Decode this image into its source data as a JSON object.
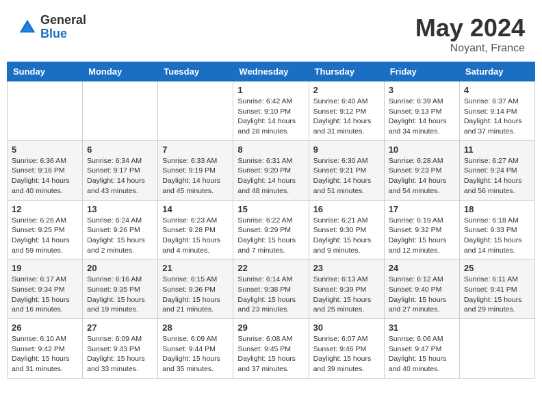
{
  "logo": {
    "general": "General",
    "blue": "Blue"
  },
  "header": {
    "month": "May 2024",
    "location": "Noyant, France"
  },
  "weekdays": [
    "Sunday",
    "Monday",
    "Tuesday",
    "Wednesday",
    "Thursday",
    "Friday",
    "Saturday"
  ],
  "weeks": [
    [
      {
        "day": "",
        "info": ""
      },
      {
        "day": "",
        "info": ""
      },
      {
        "day": "",
        "info": ""
      },
      {
        "day": "1",
        "info": "Sunrise: 6:42 AM\nSunset: 9:10 PM\nDaylight: 14 hours\nand 28 minutes."
      },
      {
        "day": "2",
        "info": "Sunrise: 6:40 AM\nSunset: 9:12 PM\nDaylight: 14 hours\nand 31 minutes."
      },
      {
        "day": "3",
        "info": "Sunrise: 6:39 AM\nSunset: 9:13 PM\nDaylight: 14 hours\nand 34 minutes."
      },
      {
        "day": "4",
        "info": "Sunrise: 6:37 AM\nSunset: 9:14 PM\nDaylight: 14 hours\nand 37 minutes."
      }
    ],
    [
      {
        "day": "5",
        "info": "Sunrise: 6:36 AM\nSunset: 9:16 PM\nDaylight: 14 hours\nand 40 minutes."
      },
      {
        "day": "6",
        "info": "Sunrise: 6:34 AM\nSunset: 9:17 PM\nDaylight: 14 hours\nand 43 minutes."
      },
      {
        "day": "7",
        "info": "Sunrise: 6:33 AM\nSunset: 9:19 PM\nDaylight: 14 hours\nand 45 minutes."
      },
      {
        "day": "8",
        "info": "Sunrise: 6:31 AM\nSunset: 9:20 PM\nDaylight: 14 hours\nand 48 minutes."
      },
      {
        "day": "9",
        "info": "Sunrise: 6:30 AM\nSunset: 9:21 PM\nDaylight: 14 hours\nand 51 minutes."
      },
      {
        "day": "10",
        "info": "Sunrise: 6:28 AM\nSunset: 9:23 PM\nDaylight: 14 hours\nand 54 minutes."
      },
      {
        "day": "11",
        "info": "Sunrise: 6:27 AM\nSunset: 9:24 PM\nDaylight: 14 hours\nand 56 minutes."
      }
    ],
    [
      {
        "day": "12",
        "info": "Sunrise: 6:26 AM\nSunset: 9:25 PM\nDaylight: 14 hours\nand 59 minutes."
      },
      {
        "day": "13",
        "info": "Sunrise: 6:24 AM\nSunset: 9:26 PM\nDaylight: 15 hours\nand 2 minutes."
      },
      {
        "day": "14",
        "info": "Sunrise: 6:23 AM\nSunset: 9:28 PM\nDaylight: 15 hours\nand 4 minutes."
      },
      {
        "day": "15",
        "info": "Sunrise: 6:22 AM\nSunset: 9:29 PM\nDaylight: 15 hours\nand 7 minutes."
      },
      {
        "day": "16",
        "info": "Sunrise: 6:21 AM\nSunset: 9:30 PM\nDaylight: 15 hours\nand 9 minutes."
      },
      {
        "day": "17",
        "info": "Sunrise: 6:19 AM\nSunset: 9:32 PM\nDaylight: 15 hours\nand 12 minutes."
      },
      {
        "day": "18",
        "info": "Sunrise: 6:18 AM\nSunset: 9:33 PM\nDaylight: 15 hours\nand 14 minutes."
      }
    ],
    [
      {
        "day": "19",
        "info": "Sunrise: 6:17 AM\nSunset: 9:34 PM\nDaylight: 15 hours\nand 16 minutes."
      },
      {
        "day": "20",
        "info": "Sunrise: 6:16 AM\nSunset: 9:35 PM\nDaylight: 15 hours\nand 19 minutes."
      },
      {
        "day": "21",
        "info": "Sunrise: 6:15 AM\nSunset: 9:36 PM\nDaylight: 15 hours\nand 21 minutes."
      },
      {
        "day": "22",
        "info": "Sunrise: 6:14 AM\nSunset: 9:38 PM\nDaylight: 15 hours\nand 23 minutes."
      },
      {
        "day": "23",
        "info": "Sunrise: 6:13 AM\nSunset: 9:39 PM\nDaylight: 15 hours\nand 25 minutes."
      },
      {
        "day": "24",
        "info": "Sunrise: 6:12 AM\nSunset: 9:40 PM\nDaylight: 15 hours\nand 27 minutes."
      },
      {
        "day": "25",
        "info": "Sunrise: 6:11 AM\nSunset: 9:41 PM\nDaylight: 15 hours\nand 29 minutes."
      }
    ],
    [
      {
        "day": "26",
        "info": "Sunrise: 6:10 AM\nSunset: 9:42 PM\nDaylight: 15 hours\nand 31 minutes."
      },
      {
        "day": "27",
        "info": "Sunrise: 6:09 AM\nSunset: 9:43 PM\nDaylight: 15 hours\nand 33 minutes."
      },
      {
        "day": "28",
        "info": "Sunrise: 6:09 AM\nSunset: 9:44 PM\nDaylight: 15 hours\nand 35 minutes."
      },
      {
        "day": "29",
        "info": "Sunrise: 6:08 AM\nSunset: 9:45 PM\nDaylight: 15 hours\nand 37 minutes."
      },
      {
        "day": "30",
        "info": "Sunrise: 6:07 AM\nSunset: 9:46 PM\nDaylight: 15 hours\nand 39 minutes."
      },
      {
        "day": "31",
        "info": "Sunrise: 6:06 AM\nSunset: 9:47 PM\nDaylight: 15 hours\nand 40 minutes."
      },
      {
        "day": "",
        "info": ""
      }
    ]
  ]
}
